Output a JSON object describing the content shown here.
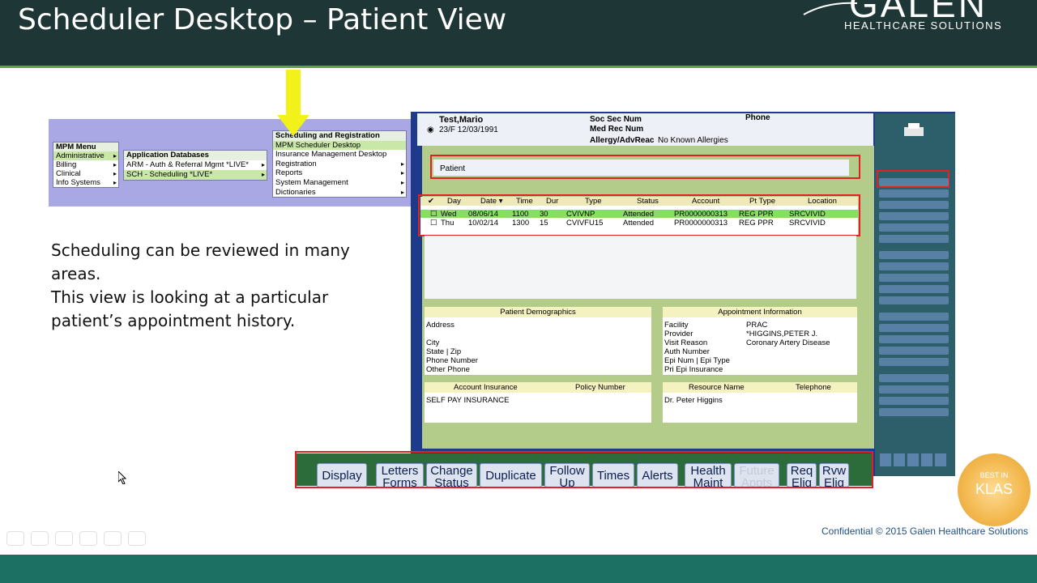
{
  "slide": {
    "title": "Scheduler Desktop – Patient View",
    "logo_mark": "GALEN",
    "logo_sub": "HEALTHCARE SOLUTIONS",
    "description_line1": "Scheduling can be reviewed in many areas.",
    "description_line2": "This view is looking at a particular patient’s appointment history.",
    "confidential": "Confidential © 2015 Galen Healthcare Solutions",
    "klas_top": "BEST IN",
    "klas_mid": "KLAS"
  },
  "menu": {
    "mpm_header": "MPM Menu",
    "mpm_items": [
      "Administrative",
      "Billing",
      "Clinical",
      "Info Systems"
    ],
    "apps_header": "Application Databases",
    "apps_items": [
      "ARM - Auth & Referral Mgmt *LIVE*",
      "SCH - Scheduling *LIVE*"
    ],
    "sched_header": "Scheduling and Registration",
    "sched_items": [
      "MPM Scheduler Desktop",
      "Insurance Management Desktop",
      "Registration",
      "Reports",
      "System Management",
      "Dictionaries"
    ]
  },
  "patient": {
    "name": "Test,Mario",
    "age_dob": "23/F  12/03/1991",
    "ssn_label": "Soc Sec Num",
    "mrn_label": "Med Rec Num",
    "allergy_label": "Allergy/AdvReac",
    "allergy_value": "No Known Allergies",
    "phone_label": "Phone"
  },
  "patient_field_label": "Patient",
  "appointments": {
    "columns": [
      "✔",
      "Day",
      "Date ▾",
      "Time",
      "Dur",
      "Type",
      "Status",
      "Account",
      "Pt Type",
      "Location"
    ],
    "rows": [
      [
        "Wed",
        "08/06/14",
        "1100",
        "30",
        "CVIVNP",
        "Attended",
        "PR0000000313",
        "REG PPR",
        "SRCVIVID"
      ],
      [
        "Thu",
        "10/02/14",
        "1300",
        "15",
        "CVIVFU15",
        "Attended",
        "PR0000000313",
        "REG PPR",
        "SRCVIVID"
      ]
    ]
  },
  "demographics": {
    "header": "Patient Demographics",
    "labels": [
      "Address",
      "City",
      "State | Zip",
      "Phone Number",
      "Other Phone"
    ]
  },
  "appointment_info": {
    "header": "Appointment Information",
    "labels": [
      "Facility",
      "Provider",
      "Visit Reason",
      "Auth Number",
      "Epi Num | Epi Type",
      "Pri Epi Insurance"
    ],
    "values": [
      "PRAC",
      "*HIGGINS,PETER J.",
      "Coronary Artery Disease"
    ]
  },
  "insurance": {
    "col1": "Account Insurance",
    "col2": "Policy Number",
    "value": "SELF PAY INSURANCE"
  },
  "resource": {
    "col1": "Resource Name",
    "col2": "Telephone",
    "value": "Dr. Peter Higgins"
  },
  "toolbar": {
    "display": "Display",
    "letters1": "Letters",
    "letters2": "Forms",
    "change1": "Change",
    "change2": "Status",
    "duplicate": "Duplicate",
    "follow1": "Follow",
    "follow2": "Up",
    "times": "Times",
    "alerts": "Alerts",
    "health1": "Health",
    "health2": "Maint",
    "future1": "Future",
    "future2": "Appts",
    "req1": "Req",
    "req2": "Elig",
    "rvw1": "Rvw",
    "rvw2": "Elig"
  },
  "colors": {
    "header_bg": "#1e3736",
    "accent_green": "#5aa63f",
    "highlight_red": "#e32025",
    "app_blue": "#1e3a8a"
  }
}
